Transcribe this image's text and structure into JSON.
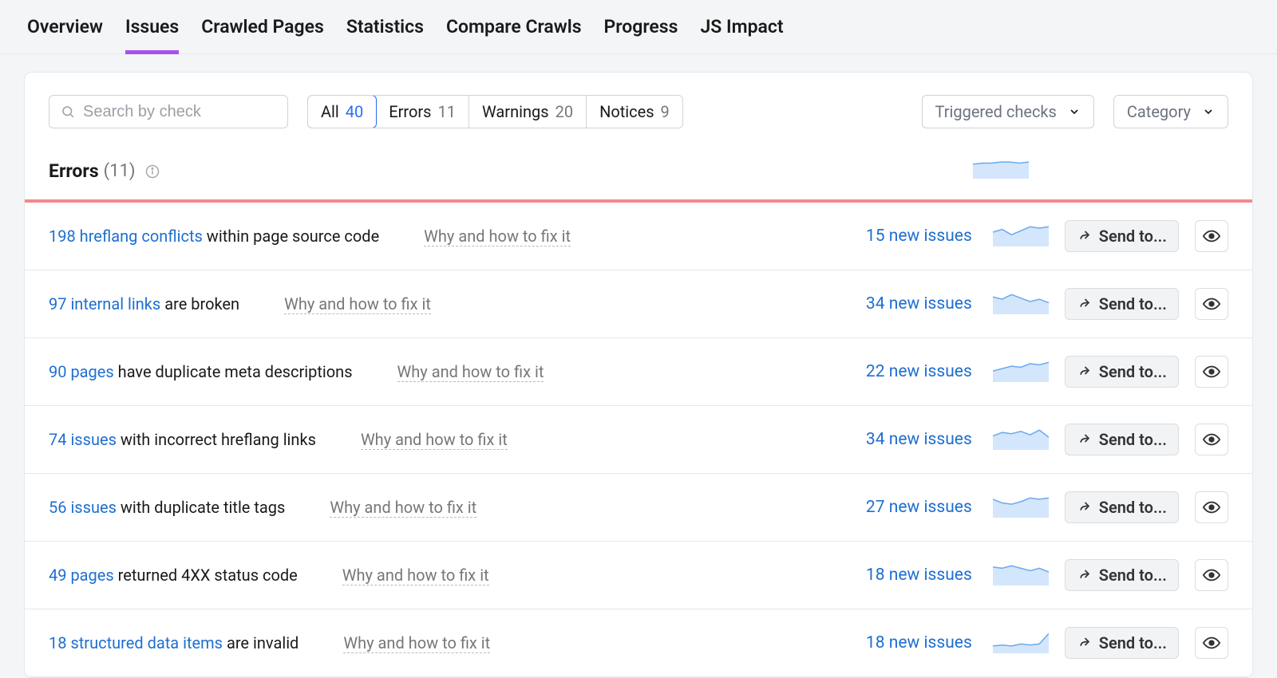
{
  "tabs": [
    "Overview",
    "Issues",
    "Crawled Pages",
    "Statistics",
    "Compare Crawls",
    "Progress",
    "JS Impact"
  ],
  "active_tab": "Issues",
  "search_placeholder": "Search by check",
  "filters": [
    {
      "label": "All",
      "count": 40,
      "active": true
    },
    {
      "label": "Errors",
      "count": 11,
      "active": false
    },
    {
      "label": "Warnings",
      "count": 20,
      "active": false
    },
    {
      "label": "Notices",
      "count": 9,
      "active": false
    }
  ],
  "dropdowns": {
    "triggered": "Triggered checks",
    "category": "Category"
  },
  "section": {
    "title": "Errors",
    "count": "(11)"
  },
  "why_label": "Why and how to fix it",
  "send_label": "Send to...",
  "header_spark": [
    12,
    13,
    13,
    14,
    14,
    13,
    14
  ],
  "rows": [
    {
      "link": "198 hreflang conflicts",
      "rest": " within page source code",
      "new_issues": "15 new issues",
      "spark": [
        10,
        12,
        8,
        11,
        14,
        13,
        14
      ]
    },
    {
      "link": "97 internal links",
      "rest": " are broken",
      "new_issues": "34 new issues",
      "spark": [
        14,
        12,
        16,
        13,
        10,
        12,
        9
      ]
    },
    {
      "link": "90 pages",
      "rest": " have duplicate meta descriptions",
      "new_issues": "22 new issues",
      "spark": [
        8,
        10,
        12,
        11,
        14,
        13,
        15
      ]
    },
    {
      "link": "74 issues",
      "rest": " with incorrect hreflang links",
      "new_issues": "34 new issues",
      "spark": [
        11,
        14,
        13,
        15,
        12,
        16,
        10
      ]
    },
    {
      "link": "56 issues",
      "rest": " with duplicate title tags",
      "new_issues": "27 new issues",
      "spark": [
        14,
        11,
        10,
        12,
        15,
        14,
        15
      ]
    },
    {
      "link": "49 pages",
      "rest": " returned 4XX status code",
      "new_issues": "18 new issues",
      "spark": [
        14,
        13,
        15,
        13,
        11,
        13,
        10
      ]
    },
    {
      "link": "18 structured data items",
      "rest": " are invalid",
      "new_issues": "18 new issues",
      "spark": [
        6,
        7,
        6,
        8,
        7,
        8,
        18
      ]
    }
  ]
}
